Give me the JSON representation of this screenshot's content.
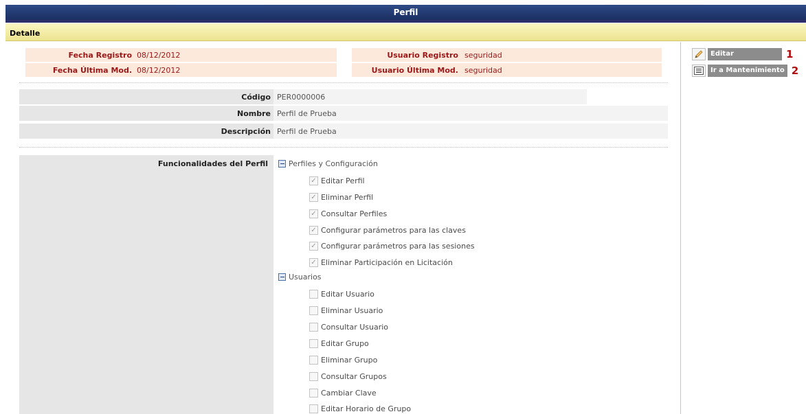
{
  "window": {
    "title": "Perfil"
  },
  "section": {
    "title": "Detalle"
  },
  "audit": {
    "fecha_registro_label": "Fecha Registro",
    "fecha_registro_value": "08/12/2012",
    "fecha_ultima_mod_label": "Fecha Última Mod.",
    "fecha_ultima_mod_value": "08/12/2012",
    "usuario_registro_label": "Usuario Registro",
    "usuario_registro_value": "seguridad",
    "usuario_ultima_mod_label": "Usuario Última Mod.",
    "usuario_ultima_mod_value": "seguridad"
  },
  "form": {
    "codigo_label": "Código",
    "codigo_value": "PER0000006",
    "nombre_label": "Nombre",
    "nombre_value": "Perfil de Prueba",
    "descripcion_label": "Descripción",
    "descripcion_value": "Perfil de Prueba"
  },
  "functionalities": {
    "label": "Funcionalidades del Perfil",
    "groups": [
      {
        "label": "Perfiles y Configuración",
        "items": [
          {
            "label": "Editar Perfil",
            "checked": true
          },
          {
            "label": "Eliminar Perfil",
            "checked": true
          },
          {
            "label": "Consultar Perfiles",
            "checked": true
          },
          {
            "label": "Configurar parámetros para las claves",
            "checked": true
          },
          {
            "label": "Configurar parámetros para las sesiones",
            "checked": true
          },
          {
            "label": "Eliminar Participación en Licitación",
            "checked": true
          }
        ]
      },
      {
        "label": "Usuarios",
        "items": [
          {
            "label": "Editar Usuario",
            "checked": false
          },
          {
            "label": "Eliminar Usuario",
            "checked": false
          },
          {
            "label": "Consultar Usuario",
            "checked": false
          },
          {
            "label": "Editar Grupo",
            "checked": false
          },
          {
            "label": "Eliminar Grupo",
            "checked": false
          },
          {
            "label": "Consultar Grupos",
            "checked": false
          },
          {
            "label": "Cambiar Clave",
            "checked": false
          },
          {
            "label": "Editar Horario de Grupo",
            "checked": false
          }
        ]
      }
    ]
  },
  "actions": [
    {
      "label": "Editar",
      "number": "1",
      "icon": "pencil-icon"
    },
    {
      "label": "Ir a Mantenimiento",
      "number": "2",
      "icon": "list-icon"
    }
  ],
  "colors": {
    "header": "#1b2f62",
    "audit_bg": "#fce9dc",
    "audit_text": "#9b1717",
    "accent_number": "#b10f0f"
  }
}
